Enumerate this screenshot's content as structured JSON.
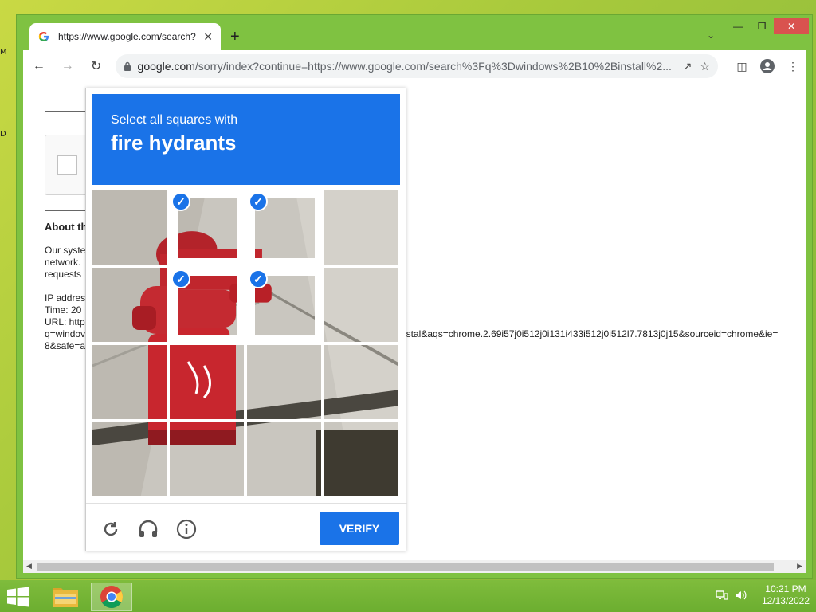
{
  "desktop": {
    "left_chars": [
      "M",
      "D"
    ]
  },
  "browser": {
    "tab_title": "https://www.google.com/search?",
    "url_domain": "google.com",
    "url_rest": "/sorry/index?continue=https://www.google.com/search%3Fq%3Dwindows%2B10%2Binstall%2..."
  },
  "page": {
    "about_heading": "About th",
    "para1": [
      "Our syste",
      "network.",
      "requests"
    ],
    "info": [
      "IP addres",
      "Time: 20",
      "URL: http",
      "q=windov",
      "8&safe=a"
    ],
    "url_tail": "nstal&aqs=chrome.2.69i57j0i512j0i131i433i512j0i512l7.7813j0j15&sourceid=chrome&ie="
  },
  "captcha": {
    "instruction": "Select all squares with",
    "target": "fire hydrants",
    "verify_label": "VERIFY",
    "selected_tiles": [
      1,
      2,
      5,
      6
    ]
  },
  "taskbar": {
    "time": "10:21 PM",
    "date": "12/13/2022"
  }
}
